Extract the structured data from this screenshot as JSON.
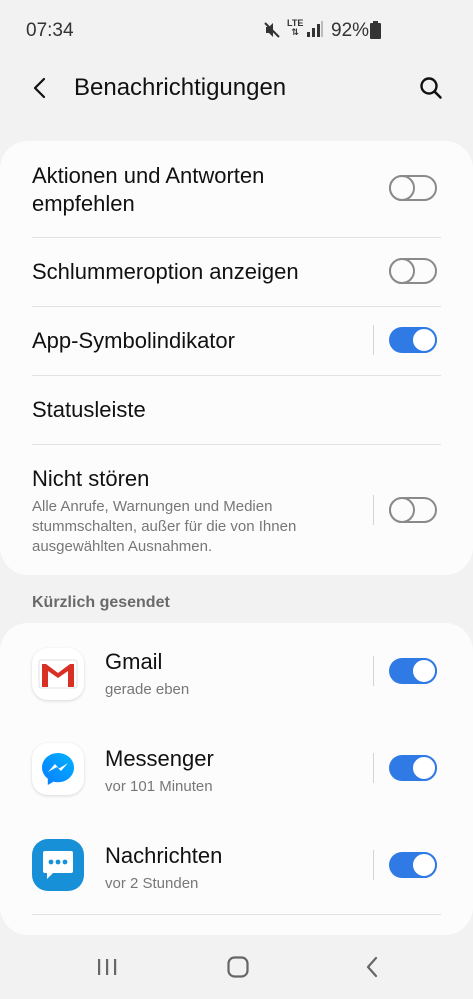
{
  "status_bar": {
    "time": "07:34",
    "network": "LTE",
    "battery": "92%",
    "icons": [
      "mute-icon",
      "lte-icon",
      "signal-icon",
      "battery-icon"
    ]
  },
  "app_bar": {
    "title": "Benachrichtigungen",
    "back_icon": "back-arrow-icon",
    "search_icon": "search-icon"
  },
  "settings": [
    {
      "title": "Aktionen und Antworten empfehlen",
      "title_lines": [
        "Aktionen und Antworten",
        "empfehlen"
      ],
      "toggle": false
    },
    {
      "title": "Schlummeroption anzeigen",
      "toggle": false
    },
    {
      "title": "App-Symbolindikator",
      "toggle": true
    },
    {
      "title": "Statusleiste"
    },
    {
      "title": "Nicht stören",
      "subtitle_lines": [
        "Alle Anrufe, Warnungen und Medien",
        "stummschalten, außer für die von Ihnen",
        "ausgewählten Ausnahmen."
      ],
      "toggle": false
    }
  ],
  "recent": {
    "header": "Kürzlich gesendet",
    "apps": [
      {
        "name": "Gmail",
        "time": "gerade eben",
        "toggle": true,
        "icon": "gmail-icon"
      },
      {
        "name": "Messenger",
        "time": "vor 101 Minuten",
        "toggle": true,
        "icon": "messenger-icon"
      },
      {
        "name": "Nachrichten",
        "time": "vor 2 Stunden",
        "toggle": true,
        "icon": "messages-icon"
      }
    ]
  },
  "nav_bar": {
    "icons": [
      "recent-apps-icon",
      "home-icon",
      "back-icon"
    ]
  },
  "colors": {
    "accent": "#2f7ae5",
    "background": "#f2f2f2",
    "card": "#fcfcfc"
  }
}
